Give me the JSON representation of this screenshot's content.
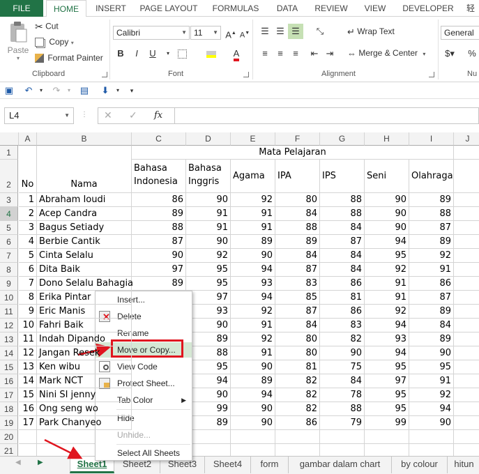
{
  "ribbon_tabs": [
    "FILE",
    "HOME",
    "INSERT",
    "PAGE LAYOUT",
    "FORMULAS",
    "DATA",
    "REVIEW",
    "VIEW",
    "DEVELOPER",
    "轻"
  ],
  "clipboard": {
    "paste": "Paste",
    "cut": "Cut",
    "copy": "Copy",
    "format_painter": "Format Painter",
    "label": "Clipboard"
  },
  "font": {
    "name": "Calibri",
    "size": "11",
    "bold": "B",
    "italic": "I",
    "underline": "U",
    "color_letter": "A",
    "label": "Font"
  },
  "alignment": {
    "wrap_text": "Wrap Text",
    "merge_center": "Merge & Center",
    "label": "Alignment"
  },
  "number": {
    "format": "General",
    "percent": "%",
    "label": "Nu"
  },
  "formula_bar": {
    "name_box": "L4",
    "fx": "fx",
    "value": ""
  },
  "columns": [
    "A",
    "B",
    "C",
    "D",
    "E",
    "F",
    "G",
    "H",
    "I",
    "J"
  ],
  "rows": [
    "1",
    "2",
    "3",
    "4",
    "5",
    "6",
    "7",
    "8",
    "9",
    "10",
    "11",
    "12",
    "13",
    "14",
    "15",
    "16",
    "17",
    "18",
    "19",
    "20",
    "21"
  ],
  "header": {
    "mata_pelajaran": "Mata Pelajaran",
    "no": "No",
    "nama": "Nama",
    "bahasa_indonesia_1": "Bahasa",
    "bahasa_indonesia_2": "Indonesia",
    "bahasa_inggris_1": "Bahasa",
    "bahasa_inggris_2": "Inggris",
    "agama": "Agama",
    "ipa": "IPA",
    "ips": "IPS",
    "seni": "Seni",
    "olahraga": "Olahraga"
  },
  "students": [
    {
      "no": "1",
      "nama": "Abraham Ioudi",
      "vals": [
        "86",
        "90",
        "92",
        "80",
        "88",
        "90",
        "89"
      ]
    },
    {
      "no": "2",
      "nama": "Acep Candra",
      "vals": [
        "89",
        "91",
        "91",
        "84",
        "88",
        "90",
        "88"
      ]
    },
    {
      "no": "3",
      "nama": "Bagus Setiady",
      "vals": [
        "88",
        "91",
        "91",
        "88",
        "84",
        "90",
        "87"
      ]
    },
    {
      "no": "4",
      "nama": "Berbie Cantik",
      "vals": [
        "87",
        "90",
        "89",
        "89",
        "87",
        "94",
        "89"
      ]
    },
    {
      "no": "5",
      "nama": "Cinta Selalu",
      "vals": [
        "90",
        "92",
        "90",
        "84",
        "84",
        "95",
        "92"
      ]
    },
    {
      "no": "6",
      "nama": "Dita Baik",
      "vals": [
        "97",
        "95",
        "94",
        "87",
        "84",
        "92",
        "91"
      ]
    },
    {
      "no": "7",
      "nama": "Dono Selalu Bahagia",
      "vals": [
        "89",
        "95",
        "93",
        "83",
        "86",
        "91",
        "86"
      ]
    },
    {
      "no": "8",
      "nama": "Erika Pintar",
      "vals": [
        "",
        "97",
        "94",
        "85",
        "81",
        "91",
        "87"
      ]
    },
    {
      "no": "9",
      "nama": "Eric Manis",
      "vals": [
        "",
        "93",
        "92",
        "87",
        "86",
        "92",
        "89"
      ]
    },
    {
      "no": "10",
      "nama": "Fahri Baik",
      "vals": [
        "",
        "90",
        "91",
        "84",
        "83",
        "94",
        "84"
      ]
    },
    {
      "no": "11",
      "nama": "Indah Dipando",
      "vals": [
        "",
        "89",
        "92",
        "80",
        "82",
        "93",
        "89"
      ]
    },
    {
      "no": "12",
      "nama": "Jangan Resek",
      "vals": [
        "",
        "88",
        "91",
        "80",
        "90",
        "94",
        "90"
      ]
    },
    {
      "no": "13",
      "nama": "Ken wibu",
      "vals": [
        "",
        "95",
        "90",
        "81",
        "75",
        "95",
        "95"
      ]
    },
    {
      "no": "14",
      "nama": "Mark NCT",
      "vals": [
        "",
        "94",
        "89",
        "82",
        "84",
        "97",
        "91"
      ]
    },
    {
      "no": "15",
      "nama": "Nini SI jenny",
      "vals": [
        "",
        "90",
        "94",
        "82",
        "78",
        "95",
        "92"
      ]
    },
    {
      "no": "16",
      "nama": "Ong seng wo",
      "vals": [
        "",
        "99",
        "90",
        "82",
        "88",
        "95",
        "94"
      ]
    },
    {
      "no": "17",
      "nama": "Park Chanyeo",
      "vals": [
        "",
        "89",
        "90",
        "86",
        "79",
        "99",
        "90"
      ]
    }
  ],
  "context_menu": {
    "insert": "Insert...",
    "delete": "Delete",
    "rename": "Rename",
    "move_or_copy": "Move or Copy...",
    "view_code": "View Code",
    "protect_sheet": "Protect Sheet...",
    "tab_color": "Tab Color",
    "hide": "Hide",
    "unhide": "Unhide...",
    "select_all_sheets": "Select All Sheets"
  },
  "sheet_tabs": [
    "Sheet1",
    "Sheet2",
    "Sheet3",
    "Sheet4",
    "form",
    "gambar dalam chart",
    "by colour",
    "hitun"
  ],
  "colors": {
    "excel_green": "#217346",
    "highlight_red": "#e0161f",
    "menu_highlight": "#d5e8d4"
  }
}
